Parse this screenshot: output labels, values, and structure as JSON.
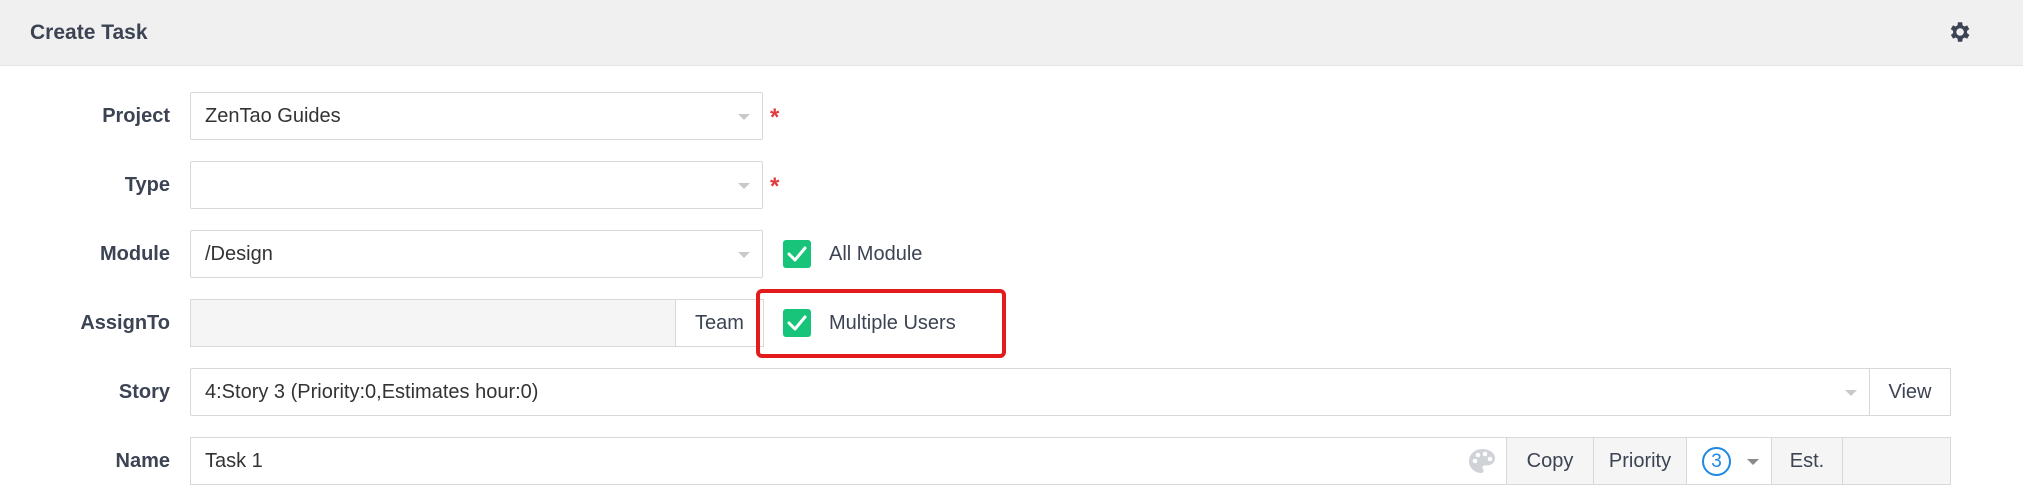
{
  "header": {
    "title": "Create Task",
    "settings_icon": "gear-icon"
  },
  "form": {
    "project": {
      "label": "Project",
      "value": "ZenTao Guides",
      "required_mark": "*"
    },
    "type": {
      "label": "Type",
      "value": "",
      "required_mark": "*"
    },
    "module": {
      "label": "Module",
      "value": "/Design",
      "all_module_label": "All Module",
      "all_module_checked": true
    },
    "assign_to": {
      "label": "AssignTo",
      "value": "",
      "team_button": "Team",
      "multiple_users_label": "Multiple Users",
      "multiple_users_checked": true
    },
    "story": {
      "label": "Story",
      "value": "4:Story 3 (Priority:0,Estimates hour:0)",
      "view_button": "View"
    },
    "name": {
      "label": "Name",
      "value": "Task 1",
      "copy_button": "Copy",
      "priority_label": "Priority",
      "priority_value": "3",
      "est_label": "Est."
    }
  },
  "colors": {
    "accent_green": "#17c47a",
    "required_red": "#e03c3c",
    "highlight_red": "#e41b1b",
    "priority_blue": "#1e88e5"
  }
}
